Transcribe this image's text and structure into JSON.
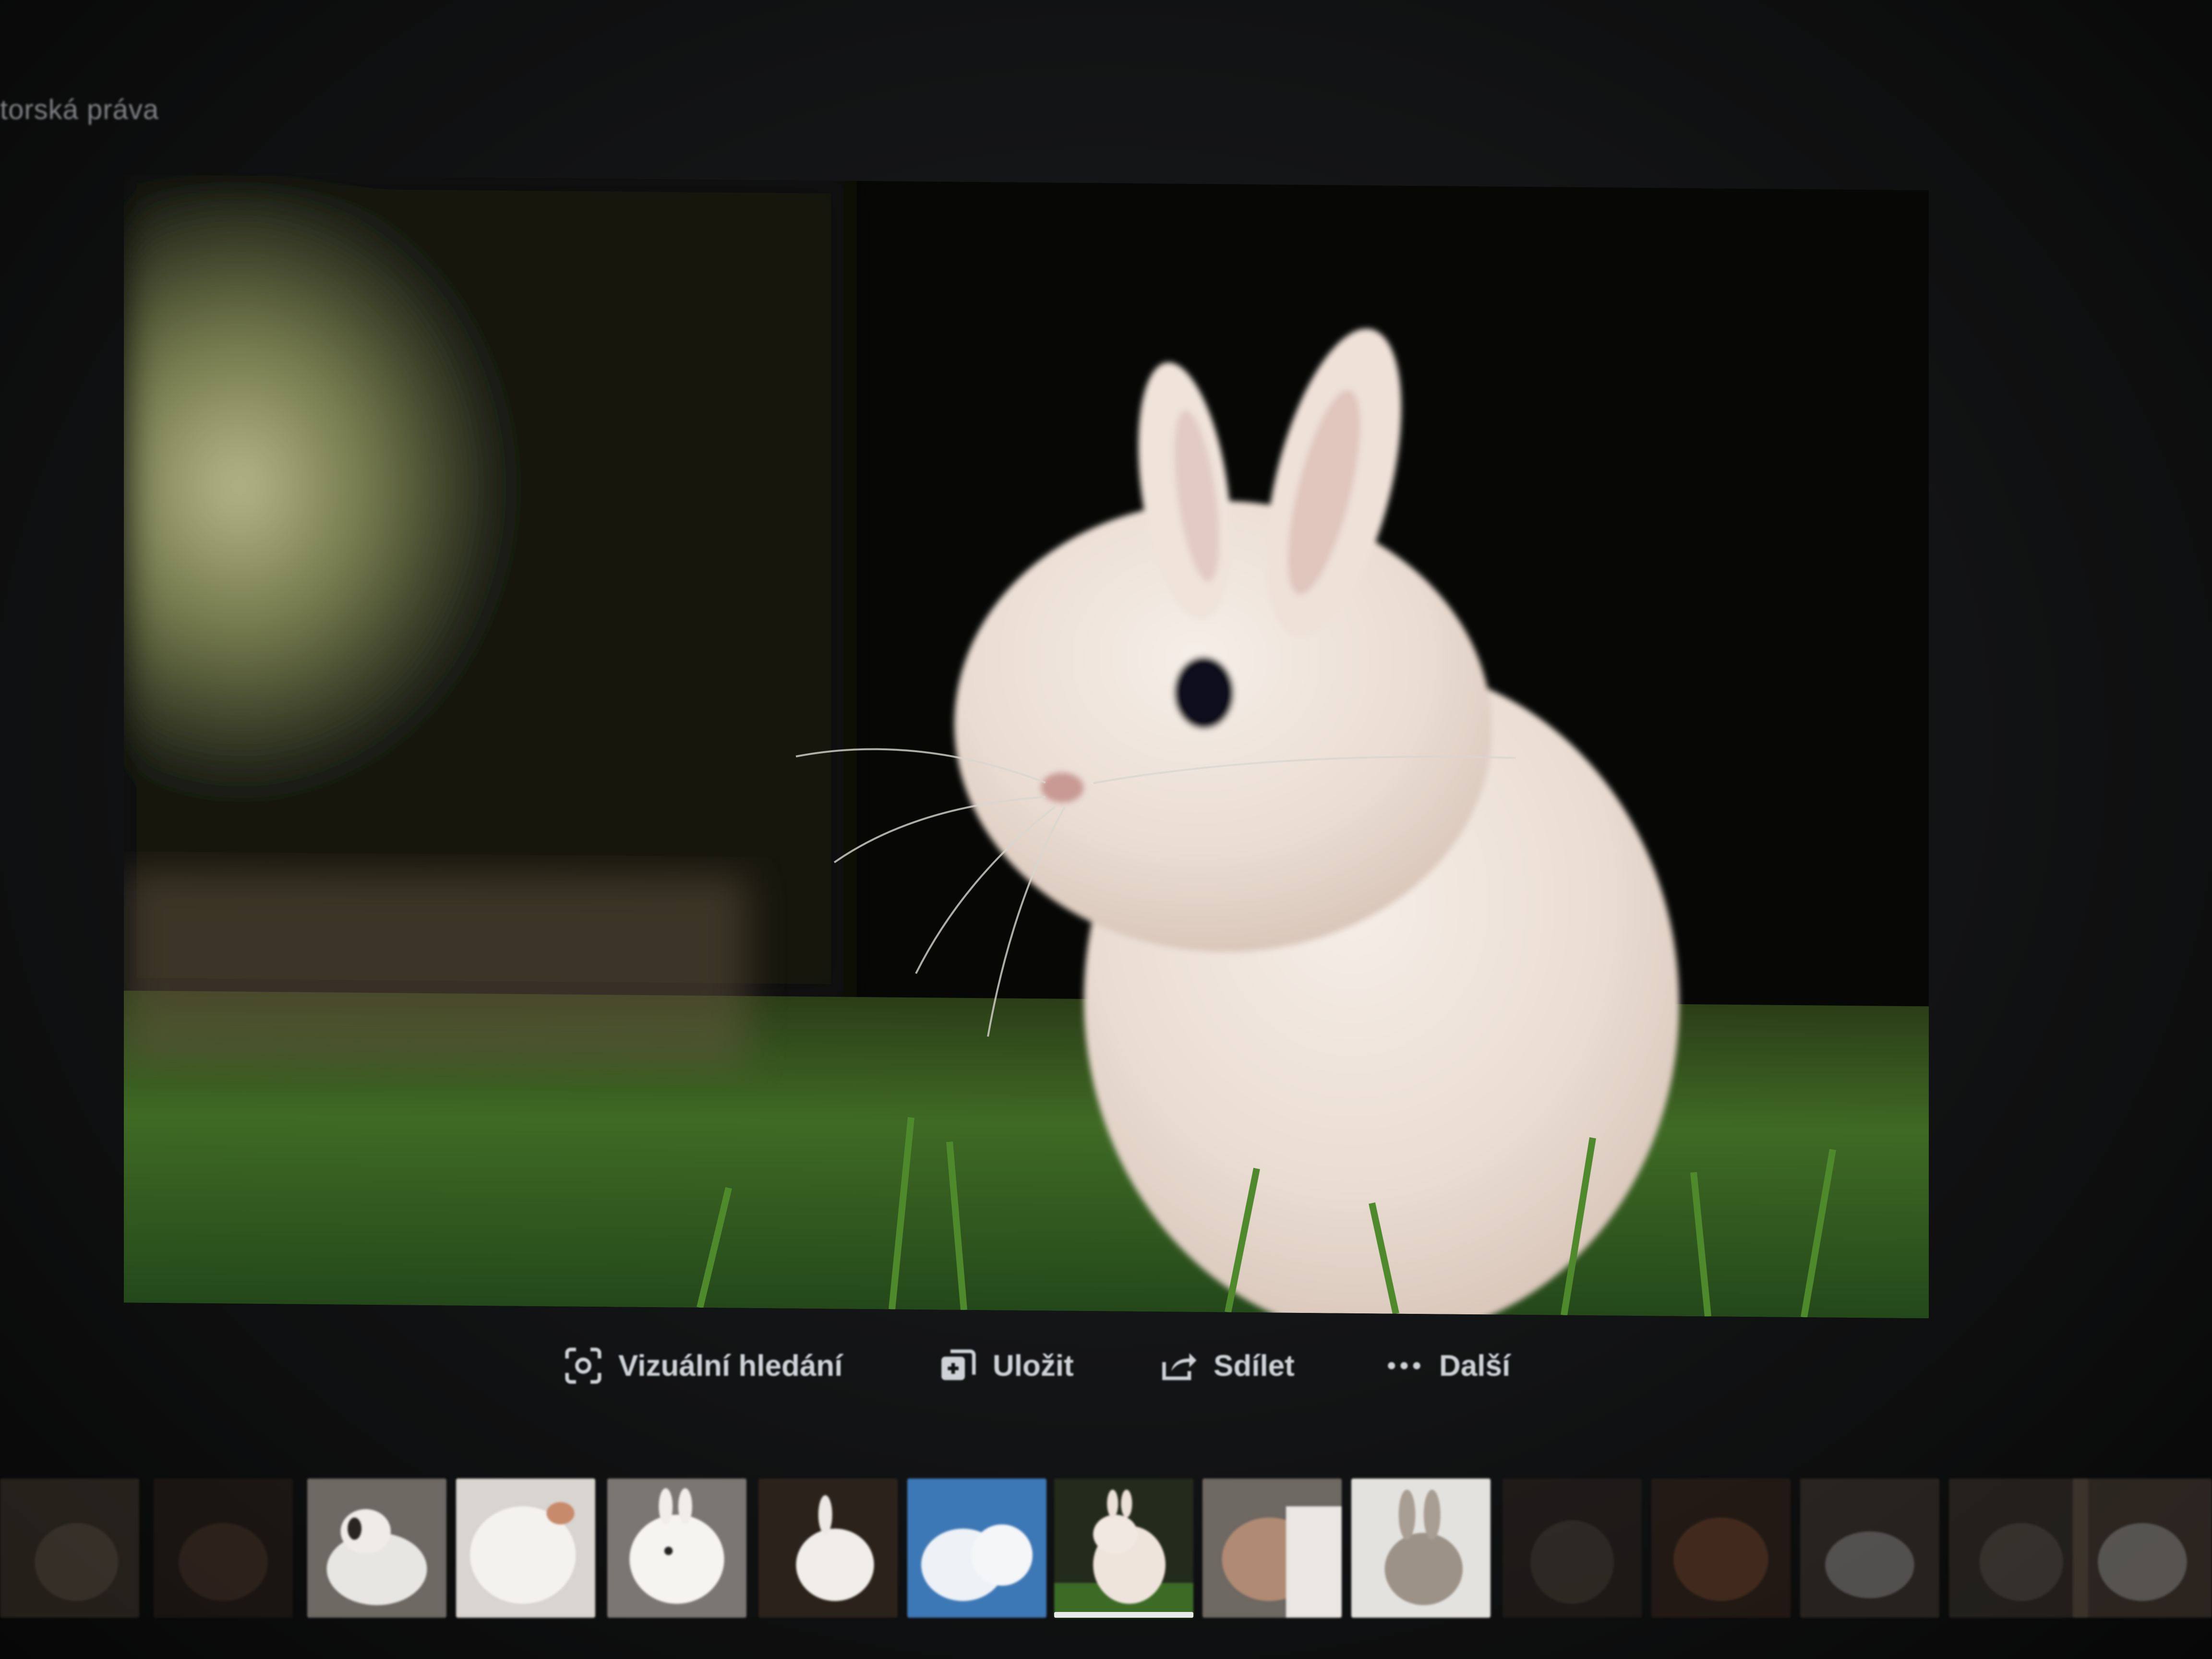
{
  "header": {
    "text": "torská práva"
  },
  "toolbar": {
    "visual_search": "Vizuální hledání",
    "save": "Uložit",
    "share": "Sdílet",
    "more": "Další"
  },
  "icons": {
    "visual_search": "visual-search-icon",
    "save": "save-collection-icon",
    "share": "share-icon",
    "more": "ellipsis-icon"
  },
  "thumbnails": {
    "count": 15,
    "selected_index": 7
  }
}
